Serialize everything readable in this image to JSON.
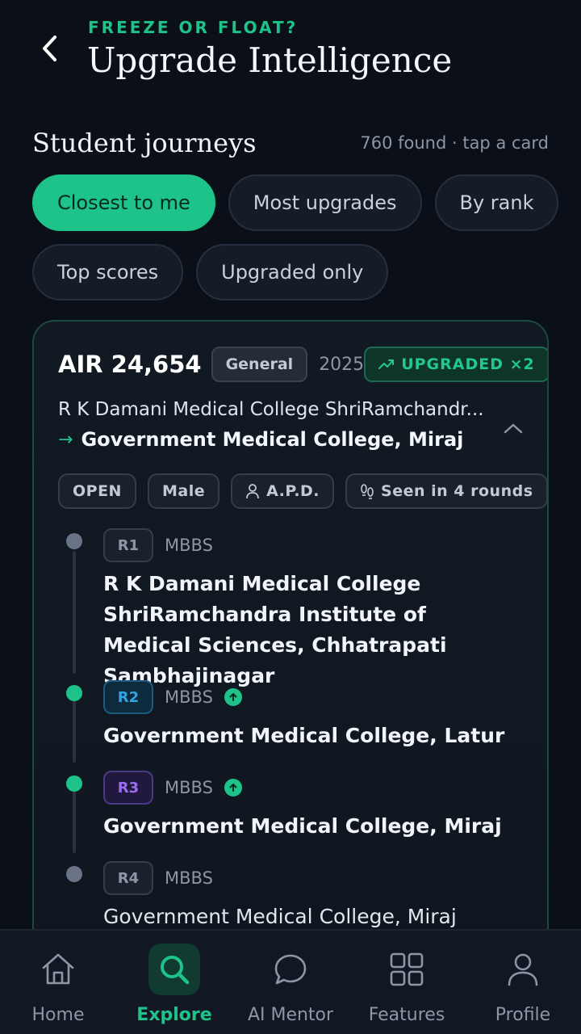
{
  "header": {
    "eyebrow": "FREEZE OR FLOAT?",
    "title": "Upgrade Intelligence",
    "back_icon": "chevron-left-icon"
  },
  "section": {
    "title": "Student journeys",
    "count": "760 found · tap a card"
  },
  "filters": [
    {
      "label": "Closest to me",
      "active": true
    },
    {
      "label": "Most upgrades",
      "active": false
    },
    {
      "label": "By rank",
      "active": false
    },
    {
      "label": "Top scores",
      "active": false
    },
    {
      "label": "Upgraded only",
      "active": false
    }
  ],
  "card": {
    "air": "AIR 24,654",
    "category": "General",
    "year": "2025",
    "upgraded": "UPGRADED ×2",
    "from_college": "R K Damani Medical College ShriRamchandr...",
    "to_college": "Government Medical College, Miraj",
    "tags": [
      "OPEN",
      "Male",
      "A.P.D.",
      "Seen in 4 rounds"
    ],
    "rounds": [
      {
        "round": "R1",
        "course": "MBBS",
        "college": "R K Damani Medical College ShriRamchandra Institute of Medical Sciences, Chhatrapati Sambhajinagar",
        "upgraded": false
      },
      {
        "round": "R2",
        "course": "MBBS",
        "college": "Government Medical College, Latur",
        "upgraded": true
      },
      {
        "round": "R3",
        "course": "MBBS",
        "college": "Government Medical College, Miraj",
        "upgraded": true
      },
      {
        "round": "R4",
        "course": "MBBS",
        "college": "Government Medical College, Miraj",
        "upgraded": false
      }
    ]
  },
  "nav": [
    {
      "label": "Home",
      "icon": "home-icon",
      "active": false
    },
    {
      "label": "Explore",
      "icon": "search-icon",
      "active": true
    },
    {
      "label": "AI Mentor",
      "icon": "chat-bubble-icon",
      "active": false
    },
    {
      "label": "Features",
      "icon": "grid-icon",
      "active": false
    },
    {
      "label": "Profile",
      "icon": "user-icon",
      "active": false
    }
  ],
  "colors": {
    "accent": "#1dc389",
    "background": "#0b0f17",
    "r2_badge": "#2fa6e3",
    "r3_badge": "#9b6cf2"
  }
}
